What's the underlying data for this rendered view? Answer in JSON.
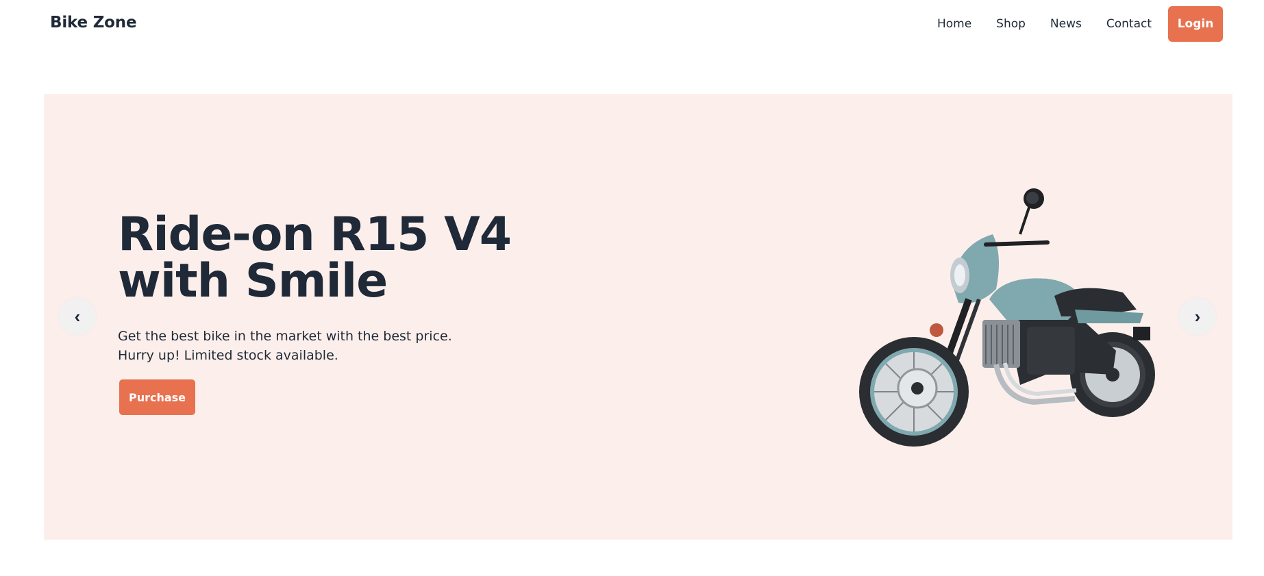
{
  "header": {
    "brand": "Bike Zone",
    "nav": [
      "Home",
      "Shop",
      "News",
      "Contact"
    ],
    "login_label": "Login"
  },
  "hero": {
    "title_line1": "Ride-on R15 V4",
    "title_line2": "with Smile",
    "subtitle_line1": "Get the best bike in the market with the best price.",
    "subtitle_line2": "Hurry up! Limited stock available.",
    "purchase_label": "Purchase",
    "prev_icon": "‹",
    "next_icon": "›"
  },
  "colors": {
    "accent": "#e8714f",
    "hero_bg": "#fcefeb",
    "text": "#1f2937",
    "bike_body": "#7fa9ae"
  },
  "icons": {
    "prev": "chevron-left-icon",
    "next": "chevron-right-icon",
    "bike": "motorcycle-image"
  }
}
